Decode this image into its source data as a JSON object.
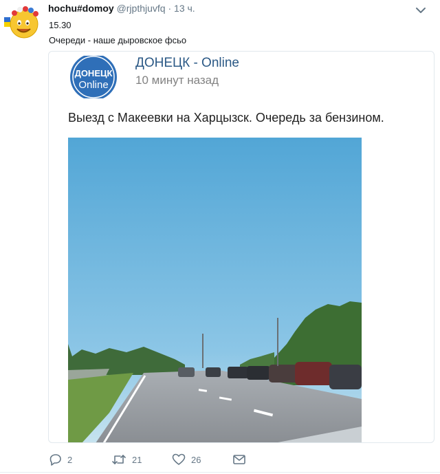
{
  "tweet": {
    "display_name": "hochu#domoy",
    "handle": "@rjpthjuvfq",
    "separator": "·",
    "time": "13 ч.",
    "text_line1": "15.30",
    "text_line2": "Очереди - наше дыровское фсьо"
  },
  "quoted_post": {
    "logo_text_top": "ДОНЕЦК",
    "logo_text_bottom": "Online",
    "group_name": "ДОНЕЦК - Online",
    "posted_ago": "10 минут назад",
    "text": "Выезд с Макеевки на Харцызск. Очередь за бензином."
  },
  "actions": {
    "reply_count": "2",
    "retweet_count": "21",
    "like_count": "26"
  },
  "icons": {
    "avatar": "emoji-face-avatar",
    "menu": "chevron-down-icon",
    "reply": "reply-icon",
    "retweet": "retweet-icon",
    "like": "heart-icon",
    "dm": "envelope-icon"
  },
  "colors": {
    "link": "#2a5885",
    "muted": "#657786",
    "logo_blue": "#2f6fb8"
  }
}
